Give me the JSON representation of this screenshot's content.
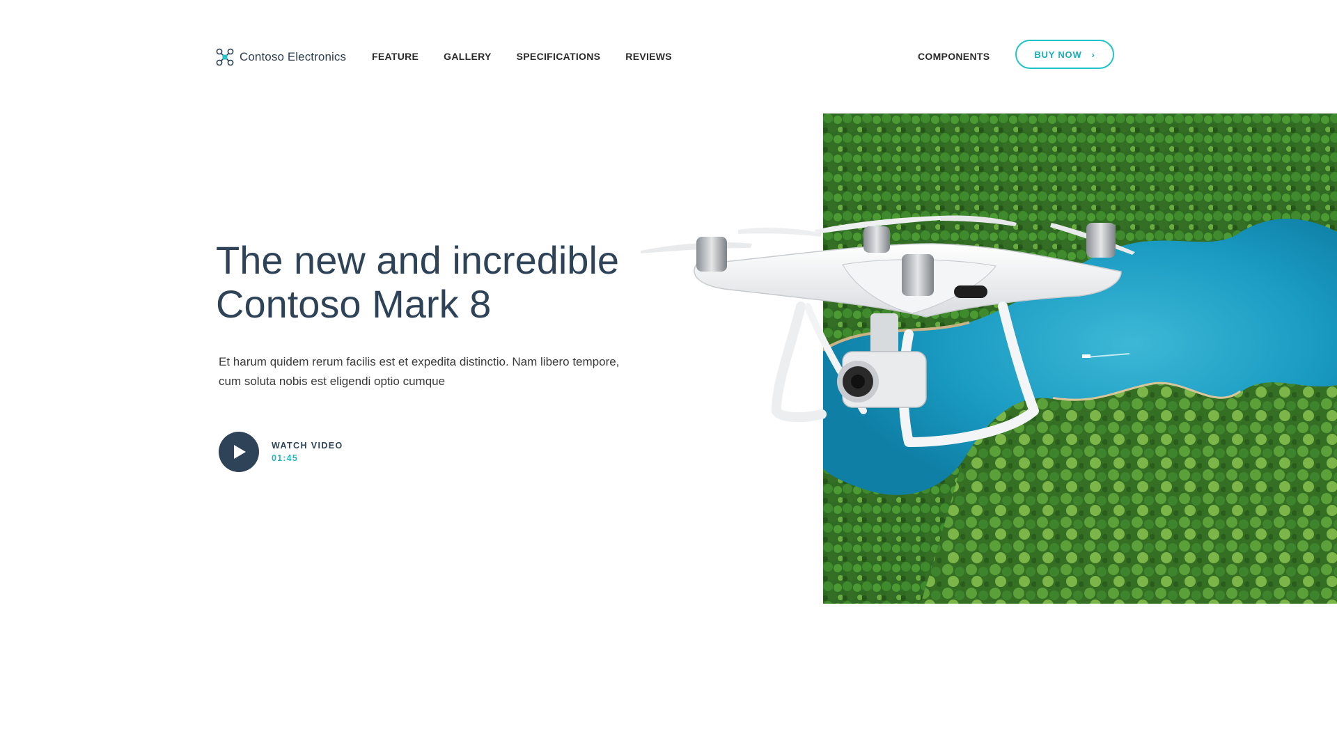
{
  "brand": {
    "name": "Contoso Electronics",
    "logo_icon": "drone-logo-icon",
    "logo_color": "#21c4c8"
  },
  "nav": {
    "items": [
      {
        "label": "FEATURE"
      },
      {
        "label": "GALLERY"
      },
      {
        "label": "SPECIFICATIONS"
      },
      {
        "label": "REVIEWS"
      }
    ],
    "right_item": "COMPONENTS",
    "buy_label": "BUY NOW",
    "buy_icon": "chevron-right-icon"
  },
  "hero": {
    "title_line1": "The new and incredible",
    "title_line2": "Contoso Mark 8",
    "description_line1": "Et harum quidem rerum facilis est et expedita distinctio. Nam libero tempore,",
    "description_line2": "cum soluta nobis est eligendi optio cumque",
    "video": {
      "label": "WATCH VIDEO",
      "duration": "01:45",
      "icon": "play-icon"
    }
  },
  "colors": {
    "accent": "#21c4c8",
    "heading": "#2e4357",
    "body_text": "#3a3a3a"
  }
}
